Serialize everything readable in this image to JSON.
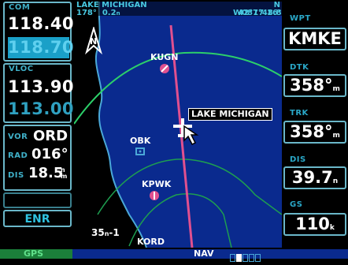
{
  "com": {
    "tag": "COM",
    "active": "118.400",
    "standby": "118.700"
  },
  "vloc": {
    "tag": "VLOC",
    "active": "113.90",
    "standby": "113.00"
  },
  "vor": {
    "tag": "VOR",
    "ident": "ORD",
    "rad_tag": "RAD",
    "rad": "016°",
    "dis_tag": "DIS",
    "dis": "18.5",
    "dis_unit_top": "n",
    "dis_unit_bot": "m"
  },
  "mode": {
    "empty": "",
    "label": "ENR"
  },
  "map": {
    "title": "LAKE MICHIGAN",
    "bearing": "178°",
    "distance": "0.2",
    "dist_unit": "n",
    "lat": "N 42°17.16'",
    "lon": "W087°48.83'",
    "north": "N",
    "waypoint_kugn": "KUGN",
    "waypoint_obk": "OBK",
    "waypoint_kpwk": "KPWK",
    "callout": "LAKE MICHIGAN",
    "range": "35",
    "range_unit": "n",
    "range_suffix": "-1",
    "kord": "KORD"
  },
  "right": {
    "wpt_label": "WPT",
    "wpt": "KMKE",
    "dtk_label": "DTK",
    "dtk": "358°",
    "dtk_unit": "m",
    "trk_label": "TRK",
    "trk": "358°",
    "trk_unit": "m",
    "dis_label": "DIS",
    "dis": "39.7",
    "dis_unit": "n",
    "gs_label": "GS",
    "gs": "110",
    "gs_unit": "k"
  },
  "bottom": {
    "gps": "GPS",
    "nav": "NAV"
  },
  "colors": {
    "accent": "#1a9fc9",
    "panel": "#6ab7c9",
    "track": "#e0508f",
    "arc": "#2ccf6a",
    "shore": "#4aa8d8"
  }
}
